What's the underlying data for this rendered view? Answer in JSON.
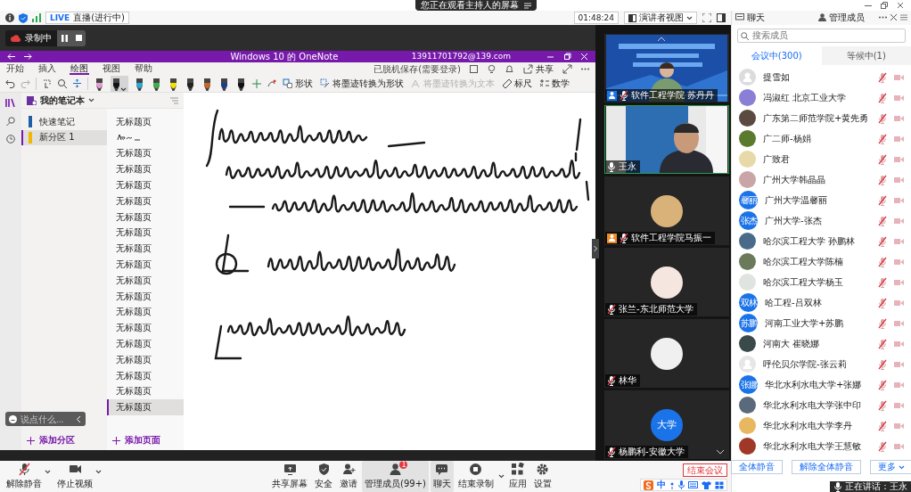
{
  "banner": {
    "text": "您正在观看主持人的屏幕"
  },
  "status": {
    "live_badge": "LIVE",
    "live_text": "直播(进行中)",
    "timer": "01:48:24",
    "view_button": "演讲者视图"
  },
  "recording": {
    "label": "录制中"
  },
  "onenote": {
    "title": "Windows 10 的 OneNote",
    "account": "13911701792@139.com",
    "menu": [
      {
        "label": "开始",
        "selected": false
      },
      {
        "label": "插入",
        "selected": false
      },
      {
        "label": "绘图",
        "selected": true
      },
      {
        "label": "视图",
        "selected": false
      },
      {
        "label": "帮助",
        "selected": false
      }
    ],
    "sync_status": "已脱机保存(需要登录)",
    "share": "共享",
    "pens": [
      {
        "color": "#e49ccf",
        "selected": false
      },
      {
        "color": "#111111",
        "selected": true
      },
      {
        "color": "#2aa8d8",
        "selected": false
      },
      {
        "color": "#3cb043",
        "selected": false
      },
      {
        "color": "#f2e200",
        "selected": false
      },
      {
        "color": "#222222",
        "selected": false
      },
      {
        "color": "#c8662a",
        "selected": false
      },
      {
        "color": "#1c3c8c",
        "selected": false
      },
      {
        "color": "#111111",
        "selected": false
      }
    ],
    "tools": [
      {
        "kind": "shapes",
        "label": "形状",
        "disabled": false
      },
      {
        "kind": "ink-to-shape",
        "label": "将墨迹转换为形状",
        "disabled": false
      },
      {
        "kind": "ink-to-text",
        "label": "将墨迹转换为文本",
        "disabled": true
      },
      {
        "kind": "ruler",
        "label": "标尺",
        "disabled": false
      },
      {
        "kind": "math",
        "label": "数学",
        "disabled": false
      }
    ],
    "notebook": "我的笔记本",
    "sections": [
      {
        "label": "快速笔记",
        "color": "#1f5fa6",
        "selected": false
      },
      {
        "label": "新分区 1",
        "color": "#f2b705",
        "selected": true
      }
    ],
    "pages": [
      {
        "kind": "text",
        "label": "无标题页",
        "selected": false
      },
      {
        "kind": "ink",
        "selected": false
      },
      {
        "kind": "text",
        "label": "无标题页",
        "selected": false
      },
      {
        "kind": "text",
        "label": "无标题页",
        "selected": false
      },
      {
        "kind": "text",
        "label": "无标题页",
        "selected": false
      },
      {
        "kind": "text",
        "label": "无标题页",
        "selected": false
      },
      {
        "kind": "text",
        "label": "无标题页",
        "selected": false
      },
      {
        "kind": "text",
        "label": "无标题页",
        "selected": false
      },
      {
        "kind": "text",
        "label": "无标题页",
        "selected": false
      },
      {
        "kind": "text",
        "label": "无标题页",
        "selected": false
      },
      {
        "kind": "text",
        "label": "无标题页",
        "selected": false
      },
      {
        "kind": "text",
        "label": "无标题页",
        "selected": false
      },
      {
        "kind": "text",
        "label": "无标题页",
        "selected": false
      },
      {
        "kind": "text",
        "label": "无标题页",
        "selected": false
      },
      {
        "kind": "text",
        "label": "无标题页",
        "selected": false
      },
      {
        "kind": "text",
        "label": "无标题页",
        "selected": false
      },
      {
        "kind": "text",
        "label": "无标题页",
        "selected": false
      },
      {
        "kind": "text",
        "label": "无标题页",
        "selected": false
      },
      {
        "kind": "text",
        "label": "无标题页",
        "selected": true
      }
    ],
    "add_section": "添加分区",
    "add_page": "添加页面"
  },
  "chat_input": {
    "placeholder": "说点什么..."
  },
  "videos": [
    {
      "kind": "slide",
      "caption": "软件工程学院 苏丹丹",
      "muted": true,
      "host": true,
      "cohost": false,
      "speaking": false
    },
    {
      "kind": "camera",
      "caption": "王永",
      "muted": false,
      "host": false,
      "cohost": false,
      "speaking": true
    },
    {
      "kind": "avatar",
      "color": "#d9b27a",
      "caption": "软件工程学院马振一",
      "muted": true,
      "host": false,
      "cohost": true,
      "speaking": false
    },
    {
      "kind": "avatar",
      "color": "#f6e6e0",
      "caption": "张兰-东北师范大学",
      "muted": true,
      "host": false,
      "cohost": false,
      "speaking": false
    },
    {
      "kind": "avatar",
      "color": "#f0f0f0",
      "caption": "林华",
      "muted": true,
      "host": false,
      "cohost": false,
      "speaking": false
    },
    {
      "kind": "initials",
      "initials": "大学",
      "caption": "杨鹏利-安徽大学",
      "muted": true,
      "host": false,
      "cohost": false,
      "speaking": false
    }
  ],
  "members_panel": {
    "headers": [
      "聊天",
      "管理成员"
    ],
    "search": {
      "placeholder": "搜索成员"
    },
    "tabs": [
      {
        "label": "会议中(300)",
        "selected": true
      },
      {
        "label": "等候中(1)",
        "selected": false
      }
    ],
    "members": [
      {
        "name": "提雪如",
        "kind": "default",
        "color": "#dcdcdc"
      },
      {
        "name": "冯淑红 北京工业大学",
        "color": "#8a7fd6"
      },
      {
        "name": "广东第二师范学院+黄先勇",
        "color": "#5a4a40"
      },
      {
        "name": "广二师-杨娟",
        "color": "#5b7a2e"
      },
      {
        "name": "广致君",
        "color": "#e8d9a8"
      },
      {
        "name": "广州大学韩晶晶",
        "color": "#c9a5a8"
      },
      {
        "name": "广州大学温馨丽",
        "kind": "initials",
        "initials": "馨丽",
        "color": "#1a73e8"
      },
      {
        "name": "广州大学-张杰",
        "kind": "initials",
        "initials": "张杰",
        "color": "#1a73e8"
      },
      {
        "name": "哈尔滨工程大学 孙鹏林",
        "color": "#4a6a8a"
      },
      {
        "name": "哈尔滨工程大学陈楠",
        "color": "#6a7a5a"
      },
      {
        "name": "哈尔滨工程大学杨玉",
        "color": "#e0e4e0"
      },
      {
        "name": "哈工程-吕双林",
        "kind": "initials",
        "initials": "双林",
        "color": "#1a73e8"
      },
      {
        "name": "河南工业大学+苏鹏",
        "kind": "initials",
        "initials": "苏鹏",
        "color": "#1a73e8"
      },
      {
        "name": "河南大 崔晓娜",
        "color": "#3a4a4a"
      },
      {
        "name": "呼伦贝尔学院-张云莉",
        "kind": "default",
        "color": "#e6e6e6"
      },
      {
        "name": "华北水利水电大学+张娜",
        "kind": "initials",
        "initials": "张娜",
        "color": "#1a73e8"
      },
      {
        "name": "华北水利水电大学张中印",
        "color": "#5a6a7a"
      },
      {
        "name": "华北水利水电大学李丹",
        "color": "#e8b860"
      },
      {
        "name": "华北水利水电大学王慧敏",
        "color": "#a03828"
      }
    ],
    "buttons": [
      "全体静音",
      "解除全体静音",
      "更多"
    ]
  },
  "toolbar": {
    "left": [
      {
        "kind": "mic",
        "label": "解除静音"
      },
      {
        "kind": "video",
        "label": "停止视频"
      }
    ],
    "center": [
      {
        "kind": "share",
        "label": "共享屏幕",
        "selected": false
      },
      {
        "kind": "security",
        "label": "安全",
        "selected": false
      },
      {
        "kind": "invite",
        "label": "邀请",
        "selected": false
      },
      {
        "kind": "members",
        "label": "管理成员(99+)",
        "badge": "1",
        "selected": true
      },
      {
        "kind": "chat",
        "label": "聊天",
        "selected": true
      },
      {
        "kind": "record",
        "label": "结束录制",
        "selected": false
      },
      {
        "kind": "apps",
        "label": "应用",
        "selected": false
      },
      {
        "kind": "settings",
        "label": "设置",
        "selected": false
      }
    ],
    "end_button": "结束会议"
  },
  "ime": {
    "label": "中"
  },
  "speaking": "正在讲话：王永"
}
